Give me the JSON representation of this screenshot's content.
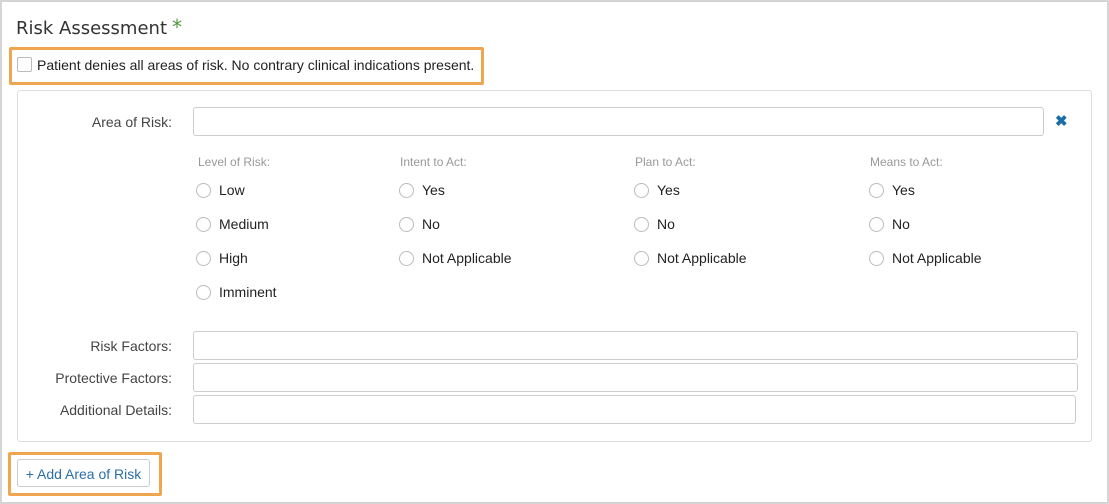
{
  "header": {
    "title": "Risk Assessment",
    "required_mark": "*"
  },
  "denial": {
    "label": "Patient denies all areas of risk. No contrary clinical indications present."
  },
  "area": {
    "label": "Area of Risk:",
    "value": "",
    "remove_glyph": "✖"
  },
  "columns": {
    "level": {
      "header": "Level of Risk:",
      "options": [
        "Low",
        "Medium",
        "High",
        "Imminent"
      ]
    },
    "intent": {
      "header": "Intent to Act:",
      "options": [
        "Yes",
        "No",
        "Not Applicable"
      ]
    },
    "plan": {
      "header": "Plan to Act:",
      "options": [
        "Yes",
        "No",
        "Not Applicable"
      ]
    },
    "means": {
      "header": "Means to Act:",
      "options": [
        "Yes",
        "No",
        "Not Applicable"
      ]
    }
  },
  "fields": {
    "risk_factors": {
      "label": "Risk Factors:",
      "value": ""
    },
    "protective_factors": {
      "label": "Protective Factors:",
      "value": ""
    },
    "additional_details": {
      "label": "Additional Details:",
      "value": ""
    }
  },
  "add_button": {
    "label": "+ Add Area of Risk"
  },
  "colors": {
    "accent_orange": "#f0a650",
    "link_blue": "#2a6fa8",
    "required_green": "#4a9a3d"
  }
}
